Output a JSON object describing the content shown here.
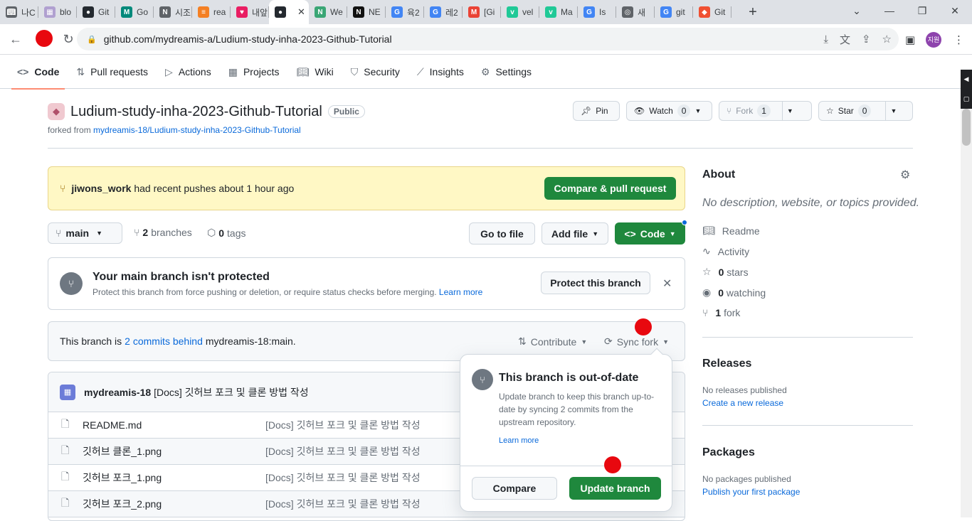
{
  "browser": {
    "tabs": [
      {
        "label": "나C",
        "icon": "book-icon",
        "color": "#5f6368"
      },
      {
        "label": "blo",
        "icon": "blog-icon",
        "color": "#b0a0d0"
      },
      {
        "label": "Git",
        "icon": "github-icon",
        "color": "#24292f"
      },
      {
        "label": "Go",
        "icon": "google-meet-icon",
        "color": "#00897b"
      },
      {
        "label": "시조",
        "icon": "notion-icon",
        "color": "#5f6368"
      },
      {
        "label": "rea",
        "icon": "stackoverflow-icon",
        "color": "#f48024"
      },
      {
        "label": "내앞",
        "icon": "heart-icon",
        "color": "#e91e63"
      },
      {
        "label": "",
        "icon": "github-icon",
        "color": "#24292f",
        "active": true
      },
      {
        "label": "We",
        "icon": "notion-n-icon",
        "color": "#3aa675"
      },
      {
        "label": "NE",
        "icon": "notion-icon",
        "color": "#111111"
      },
      {
        "label": "육2",
        "icon": "google-icon",
        "color": "#4285f4"
      },
      {
        "label": "레2",
        "icon": "google-icon",
        "color": "#4285f4"
      },
      {
        "label": "[Gi",
        "icon": "gmail-icon",
        "color": "#ea4335"
      },
      {
        "label": "vel",
        "icon": "velog-icon",
        "color": "#20c997"
      },
      {
        "label": "Ma",
        "icon": "velog-icon",
        "color": "#20c997"
      },
      {
        "label": "Is ",
        "icon": "google-icon",
        "color": "#4285f4"
      },
      {
        "label": "새",
        "icon": "chrome-icon",
        "color": "#5f6368"
      },
      {
        "label": "git",
        "icon": "google-icon",
        "color": "#4285f4"
      },
      {
        "label": "Git",
        "icon": "git-icon",
        "color": "#f05032"
      }
    ],
    "active_tab_close": "✕",
    "new_tab": "+",
    "url": "github.com/mydreamis-a/Ludium-study-inha-2023-Github-Tutorial",
    "profile": "지원"
  },
  "repo_nav": [
    {
      "label": "Code",
      "icon": "code-icon",
      "selected": true
    },
    {
      "label": "Pull requests",
      "icon": "git-pull-request-icon"
    },
    {
      "label": "Actions",
      "icon": "play-icon"
    },
    {
      "label": "Projects",
      "icon": "table-icon"
    },
    {
      "label": "Wiki",
      "icon": "book-icon"
    },
    {
      "label": "Security",
      "icon": "shield-icon"
    },
    {
      "label": "Insights",
      "icon": "graph-icon"
    },
    {
      "label": "Settings",
      "icon": "gear-icon"
    }
  ],
  "repo": {
    "name": "Ludium-study-inha-2023-Github-Tutorial",
    "visibility": "Public",
    "forked_prefix": "forked from",
    "forked_from": "mydreamis-18/Ludium-study-inha-2023-Github-Tutorial",
    "pin": "Pin",
    "watch": "Watch",
    "watch_count": "0",
    "fork": "Fork",
    "fork_count": "1",
    "star": "Star",
    "star_count": "0"
  },
  "flash": {
    "branch": "jiwons_work",
    "text": "had recent pushes about 1 hour ago",
    "button": "Compare & pull request"
  },
  "toolbar": {
    "branch": "main",
    "branches_count": "2",
    "branches_label": "branches",
    "tags_count": "0",
    "tags_label": "tags",
    "go_to_file": "Go to file",
    "add_file": "Add file",
    "code": "Code"
  },
  "protect": {
    "title": "Your main branch isn't protected",
    "desc": "Protect this branch from force pushing or deletion, or require status checks before merging.",
    "learn_more": "Learn more",
    "button": "Protect this branch"
  },
  "behind": {
    "prefix": "This branch is",
    "link": "2 commits behind",
    "suffix": "mydreamis-18:main.",
    "contribute": "Contribute",
    "sync": "Sync fork"
  },
  "commit": {
    "author": "mydreamis-18",
    "message": "[Docs] 깃허브 포크 및 클론 방법 작성"
  },
  "files": [
    {
      "name": "README.md",
      "message": "[Docs] 깃허브 포크 및 클론 방법 작성"
    },
    {
      "name": "깃허브 클론_1.png",
      "message": "[Docs] 깃허브 포크 및 클론 방법 작성"
    },
    {
      "name": "깃허브 포크_1.png",
      "message": "[Docs] 깃허브 포크 및 클론 방법 작성"
    },
    {
      "name": "깃허브 포크_2.png",
      "message": "[Docs] 깃허브 포크 및 클론 방법 작성"
    }
  ],
  "popover": {
    "title": "This branch is out-of-date",
    "desc": "Update branch to keep this branch up-to-date by syncing 2 commits from the upstream repository.",
    "learn_more": "Learn more",
    "compare": "Compare",
    "update": "Update branch"
  },
  "sidebar": {
    "about": "About",
    "no_desc": "No description, website, or topics provided.",
    "readme": "Readme",
    "activity": "Activity",
    "stars_count": "0",
    "stars_label": "stars",
    "watching_count": "0",
    "watching_label": "watching",
    "fork_count": "1",
    "fork_label": "fork",
    "releases": "Releases",
    "no_releases": "No releases published",
    "create_release": "Create a new release",
    "packages": "Packages",
    "no_packages": "No packages published",
    "publish_package": "Publish your first package"
  }
}
